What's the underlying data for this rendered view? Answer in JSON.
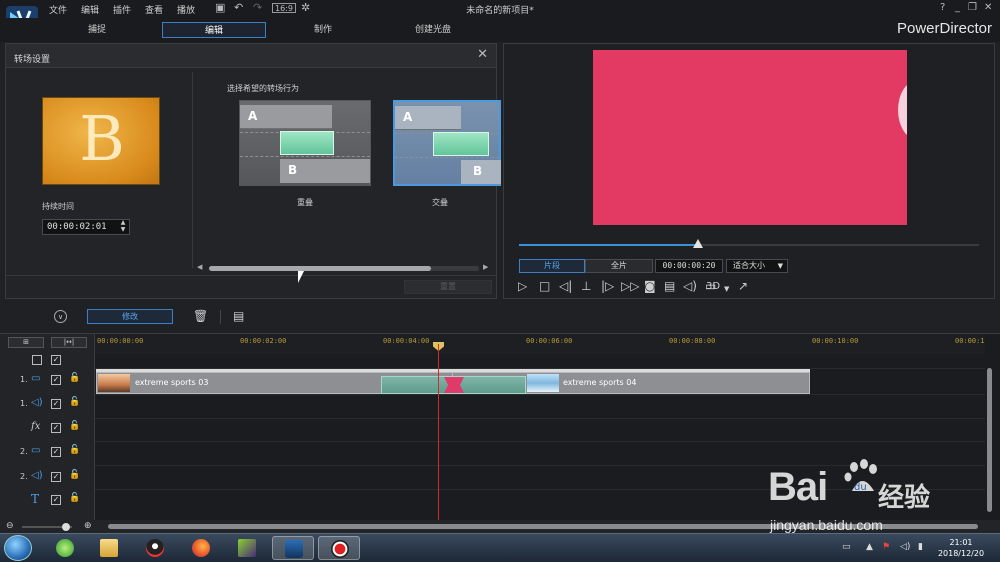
{
  "app": {
    "doc_title": "未命名的新项目*",
    "brand": "PowerDirector",
    "menu": [
      "文件",
      "编辑",
      "插件",
      "查看",
      "播放"
    ],
    "window_buttons": [
      "?",
      "_",
      "❐",
      "✕"
    ]
  },
  "mode_tabs": [
    {
      "label": "捕捉",
      "active": false
    },
    {
      "label": "编辑",
      "active": true
    },
    {
      "label": "制作",
      "active": false
    },
    {
      "label": "创建光盘",
      "active": false
    }
  ],
  "transition_panel": {
    "title": "转场设置",
    "duration_label": "持续时间",
    "duration_value": "00:00:02:01",
    "thumbnail_letter": "B",
    "choose_label": "选择希望的转场行为",
    "options": [
      {
        "label": "重叠",
        "a": "A",
        "b": "B",
        "selected": false
      },
      {
        "label": "交叠",
        "a": "A",
        "b": "B",
        "selected": true
      }
    ],
    "reset_label": "重置"
  },
  "preview": {
    "clip_mode": "片段",
    "full_mode": "全片",
    "timecode": "00:00:00:20",
    "fit_size": "适合大小",
    "mode_3d": "3D",
    "video_color": "#e23a62",
    "seek_progress": 0.39
  },
  "toolbar": {
    "modify_label": "修改"
  },
  "timeline": {
    "ruler_labels": [
      "00:00:00:00",
      "00:00:02:00",
      "00:00:04:00",
      "00:00:06:00",
      "00:00:08:00",
      "00:00:10:00",
      "00:00:1"
    ],
    "tracks": [
      {
        "num": "1.",
        "type": "video"
      },
      {
        "num": "1.",
        "type": "audio"
      },
      {
        "num": "",
        "type": "fx"
      },
      {
        "num": "2.",
        "type": "video"
      },
      {
        "num": "2.",
        "type": "audio"
      },
      {
        "num": "",
        "type": "title"
      }
    ],
    "clips": [
      {
        "label": "extreme sports 03"
      },
      {
        "label": "extreme sports 04"
      }
    ],
    "transition_color": "#e03a6a"
  },
  "watermark": {
    "text": "Bai",
    "text2": "经验",
    "du": "du",
    "url": "jingyan.baidu.com"
  },
  "taskbar": {
    "time": "21:01",
    "date": "2018/12/20"
  }
}
